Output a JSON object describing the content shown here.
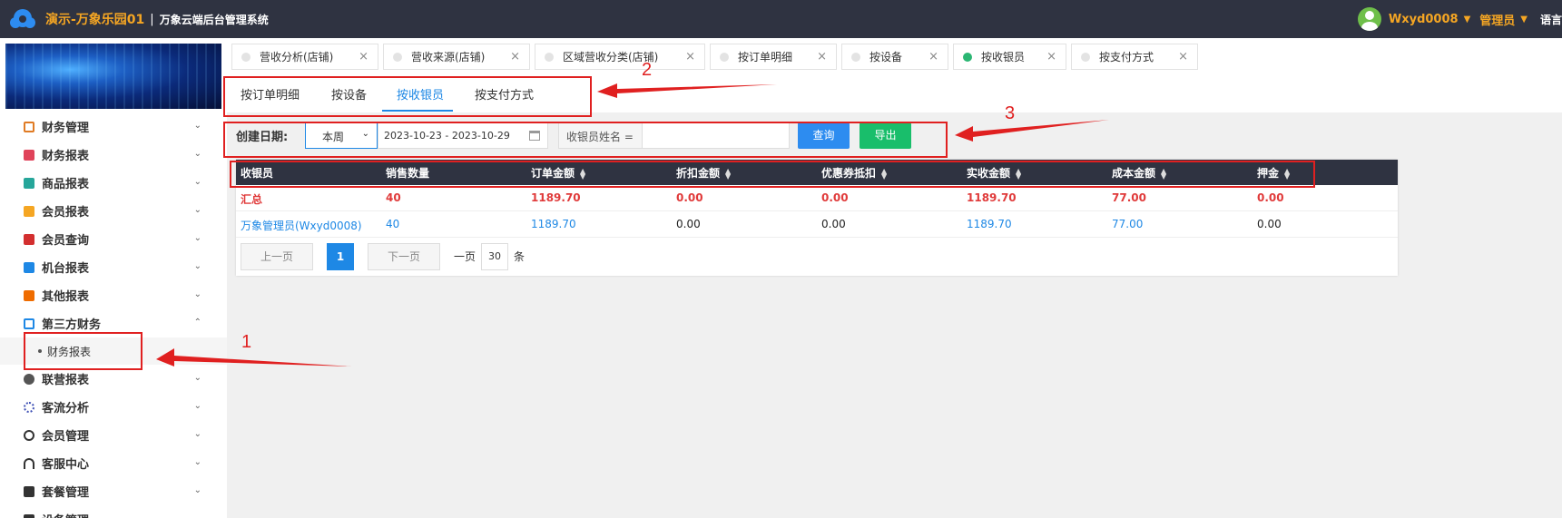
{
  "topbar": {
    "brand_name": "演示-万象乐园01",
    "separator": "|",
    "system_name": "万象云端后台管理系统",
    "user": "Wxyd0008",
    "role": "管理员",
    "language": "语言"
  },
  "sidebar": {
    "items": [
      {
        "label": "财务管理",
        "icon": "ledger-icon",
        "color": "#e07b24"
      },
      {
        "label": "财务报表",
        "icon": "report-icon",
        "color": "#e0435a"
      },
      {
        "label": "商品报表",
        "icon": "goods-icon",
        "color": "#26a69a"
      },
      {
        "label": "会员报表",
        "icon": "member-icon",
        "color": "#f5a623"
      },
      {
        "label": "会员查询",
        "icon": "member-search-icon",
        "color": "#d32f2f"
      },
      {
        "label": "机台报表",
        "icon": "machine-icon",
        "color": "#1e88e5"
      },
      {
        "label": "其他报表",
        "icon": "layers-icon",
        "color": "#ef6c00"
      },
      {
        "label": "第三方财务",
        "icon": "calculator-icon",
        "color": "#1e88e5"
      },
      {
        "label": "联营报表",
        "icon": "users-icon",
        "color": "#555555"
      },
      {
        "label": "客流分析",
        "icon": "target-icon",
        "color": "#3f51b5"
      },
      {
        "label": "会员管理",
        "icon": "user-circle-icon",
        "color": "#333333"
      },
      {
        "label": "客服中心",
        "icon": "headset-icon",
        "color": "#333333"
      },
      {
        "label": "套餐管理",
        "icon": "edit-icon",
        "color": "#333333"
      },
      {
        "label": "设备管理",
        "icon": "device-icon",
        "color": "#333333"
      }
    ],
    "sub_item": "财务报表"
  },
  "tabs": [
    {
      "label": "营收分析(店铺)",
      "active": false
    },
    {
      "label": "营收来源(店铺)",
      "active": false
    },
    {
      "label": "区域营收分类(店铺)",
      "active": false
    },
    {
      "label": "按订单明细",
      "active": false
    },
    {
      "label": "按设备",
      "active": false
    },
    {
      "label": "按收银员",
      "active": true
    },
    {
      "label": "按支付方式",
      "active": false
    }
  ],
  "subtabs": [
    "按订单明细",
    "按设备",
    "按收银员",
    "按支付方式"
  ],
  "filter": {
    "date_label": "创建日期:",
    "period": "本周",
    "date_range": "2023-10-23 - 2023-10-29",
    "cashier_label": "收银员姓名 =",
    "cashier_value": "",
    "query_button": "查询",
    "export_button": "导出"
  },
  "table": {
    "headers": [
      "收银员",
      "销售数量",
      "订单金额",
      "折扣金额",
      "优惠券抵扣",
      "实收金额",
      "成本金额",
      "押金"
    ],
    "summary": [
      "汇总",
      "40",
      "1189.70",
      "0.00",
      "0.00",
      "1189.70",
      "77.00",
      "0.00"
    ],
    "rows": [
      [
        "万象管理员(Wxyd0008)",
        "40",
        "1189.70",
        "0.00",
        "0.00",
        "1189.70",
        "77.00",
        "0.00"
      ]
    ]
  },
  "pager": {
    "prev": "上一页",
    "current": "1",
    "next": "下一页",
    "per_page_label": "一页",
    "per_page": "30",
    "unit": "条"
  },
  "annotations": [
    "1",
    "2",
    "3"
  ],
  "colors": {
    "annotation": "#e02020",
    "accent": "#1e88e5",
    "topbar": "#2f3341",
    "brand": "#f5a623",
    "export": "#19be6b"
  }
}
